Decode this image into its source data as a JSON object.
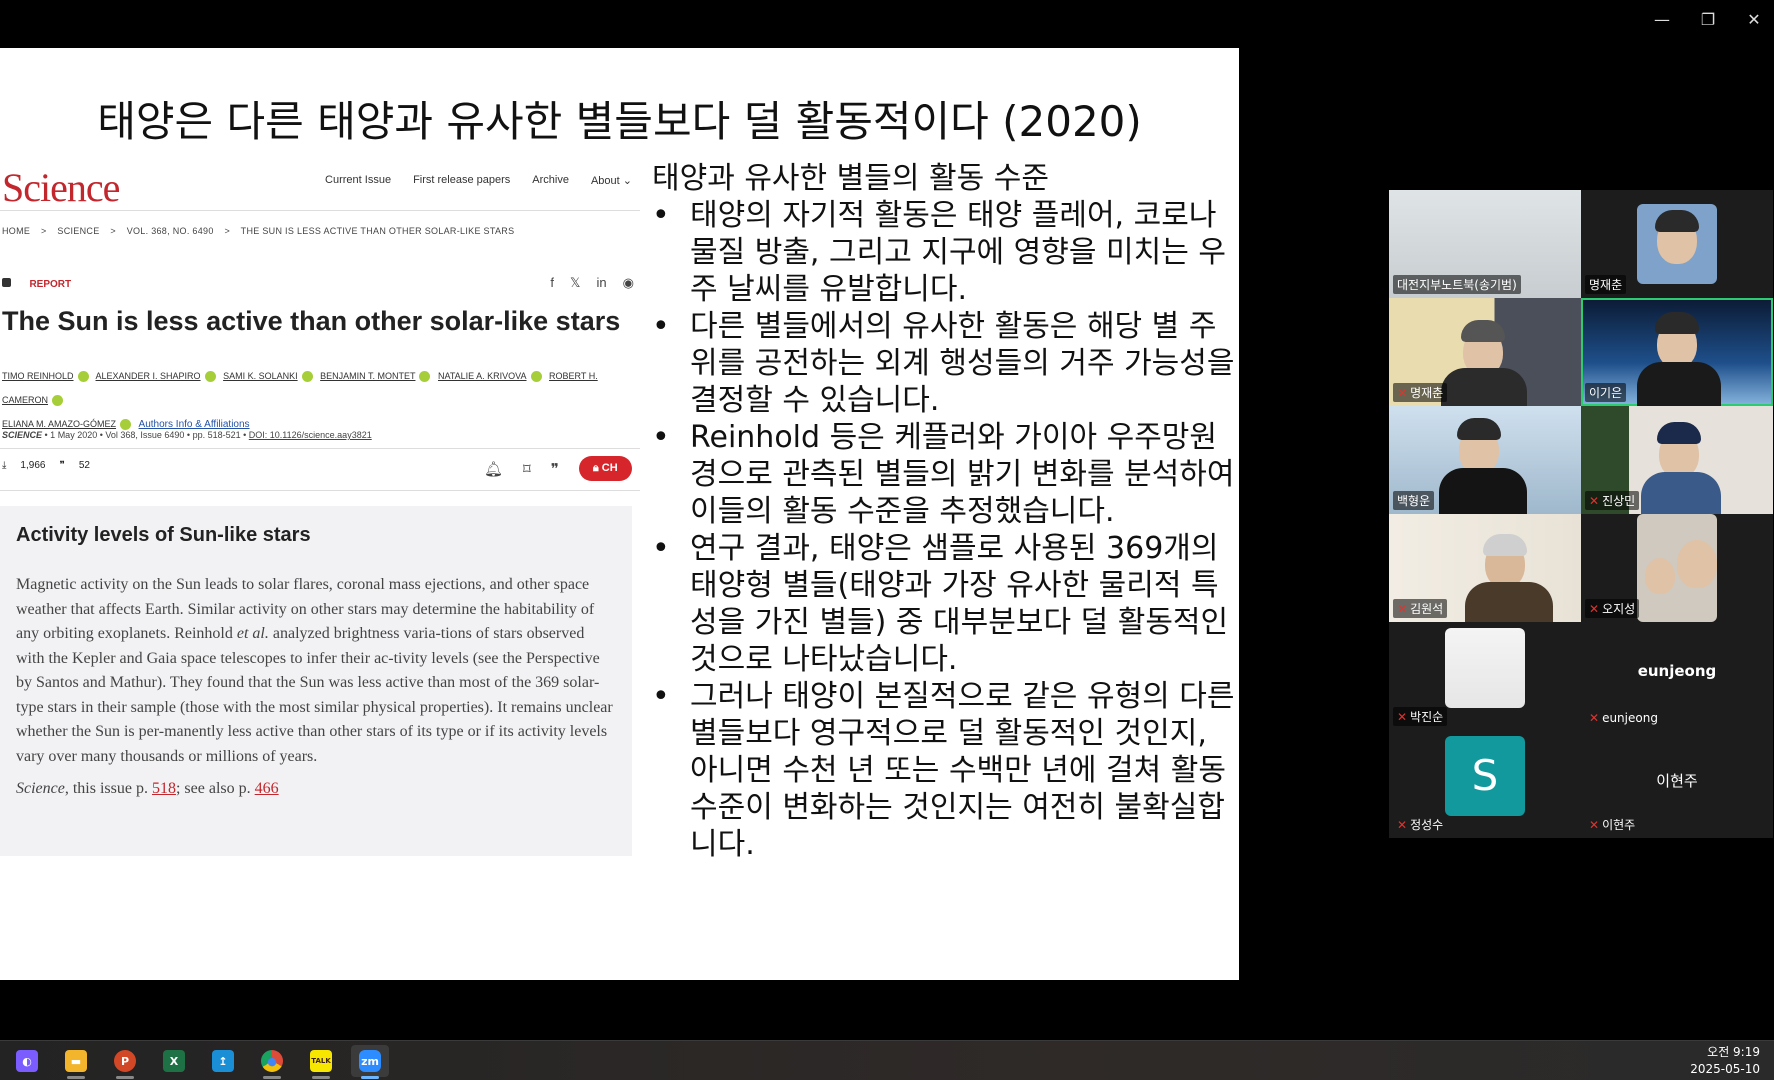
{
  "window": {
    "controls": [
      "—",
      "❐",
      "✕"
    ]
  },
  "slide": {
    "title": "태양은 다른 태양과 유사한 별들보다 덜 활동적이다 (2020)",
    "science": {
      "logo": "Science",
      "nav": [
        "Current Issue",
        "First release papers",
        "Archive",
        "About ⌄"
      ],
      "breadcrumb": [
        "HOME",
        ">",
        "SCIENCE",
        ">",
        "VOL. 368, NO. 6490",
        ">",
        "THE SUN IS LESS ACTIVE THAN OTHER SOLAR-LIKE STARS"
      ],
      "report_label": "REPORT",
      "share_icons": [
        "f",
        "𝕏",
        "in",
        "◉"
      ],
      "headline": "The Sun is less active than other solar-like stars",
      "authors": [
        "TIMO REINHOLD",
        "ALEXANDER I. SHAPIRO",
        "SAMI K. SOLANKI",
        "BENJAMIN T. MONTET",
        "NATALIE A. KRIVOVA",
        "ROBERT H. CAMERON",
        "ELIANA M. AMAZO-GÓMEZ"
      ],
      "affiliations_link": "Authors Info & Affiliations",
      "meta_journal": "SCIENCE",
      "meta_details": "• 1 May 2020 • Vol 368, Issue 6490 • pp. 518-521 •",
      "meta_doi": "DOI: 10.1126/science.aay3821",
      "downloads": "1,966",
      "citations": "52",
      "check_access": "CH",
      "summary_title": "Activity levels of Sun-like stars",
      "summary_before_etal": "Magnetic activity on the Sun leads to solar flares, coronal mass ejections, and other space weather that affects Earth. Similar activity on other stars may determine the habitability of any orbiting exoplanets. Reinhold",
      "summary_etal": "et al.",
      "summary_after_etal": "analyzed brightness varia-tions of stars observed with the Kepler and Gaia space telescopes to infer their ac-tivity levels (see the Perspective by Santos and Mathur). They found that the Sun was less active than most of the 369 solar-type stars in their sample (those with the most similar physical properties). It remains unclear whether the Sun is per-manently less active than other stars of its type or if its activity levels vary over many thousands or millions of years.",
      "ref_journal": "Science",
      "ref_text1": ", this issue p.",
      "ref_link1": "518",
      "ref_text2": "; see also p.",
      "ref_link2": "466"
    },
    "bullets_heading": "태양과 유사한 별들의 활동 수준",
    "bullets": [
      "태양의 자기적 활동은 태양 플레어, 코로나 물질 방출, 그리고 지구에 영향을 미치는 우주 날씨를 유발합니다.",
      "다른 별들에서의 유사한 활동은 해당 별 주위를 공전하는 외계 행성들의 거주 가능성을 결정할 수 있습니다.",
      "Reinhold 등은 케플러와 가이아 우주망원경으로 관측된 별들의 밝기 변화를 분석하여 이들의 활동 수준을 추정했습니다.",
      "연구 결과, 태양은 샘플로 사용된 369개의 태양형 별들(태양과 가장 유사한 물리적 특성을 가진 별들) 중 대부분보다 덜 활동적인 것으로 나타났습니다.",
      "그러나 태양이 본질적으로 같은 유형의 다른 별들보다 영구적으로 덜 활동적인 것인지, 아니면 수천 년 또는 수백만 년에 걸쳐 활동 수준이 변화하는 것인지는 여전히 불확실합니다."
    ]
  },
  "participants": [
    {
      "name": "대전지부노트북(송기범)",
      "muted": false
    },
    {
      "name": "명재춘",
      "muted": false
    },
    {
      "name": "명재춘",
      "muted": true
    },
    {
      "name": "이기은",
      "muted": false,
      "active": true
    },
    {
      "name": "백형운",
      "muted": false
    },
    {
      "name": "진상민",
      "muted": true
    },
    {
      "name": "김원석",
      "muted": true
    },
    {
      "name": "오지성",
      "muted": true
    },
    {
      "name": "박진순",
      "muted": true
    },
    {
      "name": "eunjeong",
      "muted": true,
      "display": "eunjeong"
    },
    {
      "name": "정성수",
      "muted": true,
      "avatar_letter": "S"
    },
    {
      "name": "이현주",
      "muted": true,
      "display": "이현주"
    }
  ],
  "taskbar": {
    "apps": [
      {
        "name": "copilot",
        "glyph": "◐",
        "color": "#7b5cff"
      },
      {
        "name": "file-explorer",
        "glyph": "▬",
        "color": "#f2b52c"
      },
      {
        "name": "powerpoint",
        "glyph": "P",
        "color": "#d24726"
      },
      {
        "name": "excel",
        "glyph": "X",
        "color": "#1e7145"
      },
      {
        "name": "app-blue",
        "glyph": "↥",
        "color": "#1a8fd6"
      },
      {
        "name": "chrome",
        "glyph": "●",
        "color": "#dd4b39"
      },
      {
        "name": "kakaotalk",
        "glyph": "TALK",
        "color": "#f7e600"
      },
      {
        "name": "zoom",
        "glyph": "zm",
        "color": "#2d8cff"
      }
    ],
    "time": "오전 9:19",
    "date": "2025-05-10"
  }
}
